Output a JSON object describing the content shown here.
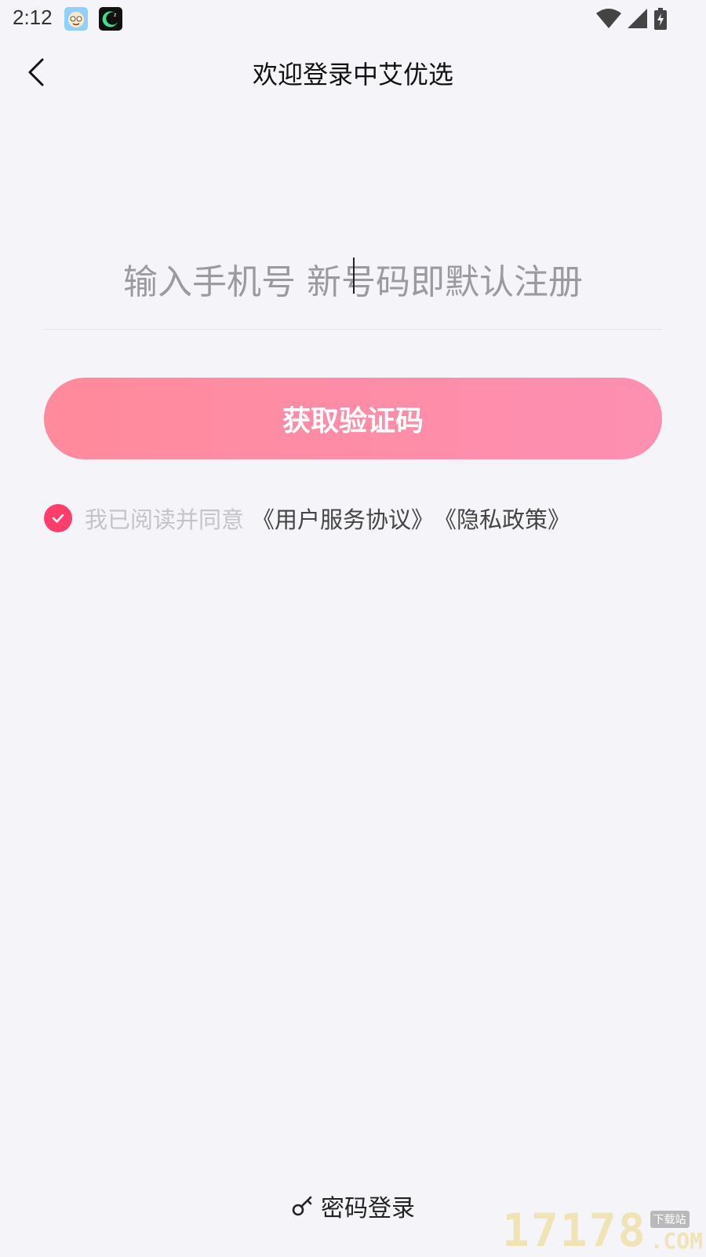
{
  "status_bar": {
    "time": "2:12",
    "icons": [
      "app-cartoon-icon",
      "app-moon-icon",
      "wifi-icon",
      "cell-signal-icon",
      "battery-charging-icon"
    ]
  },
  "header": {
    "title": "欢迎登录中艾优选",
    "back_icon": "chevron-left-icon"
  },
  "login_form": {
    "phone_placeholder": "输入手机号 新号码即默认注册",
    "get_code_label": "获取验证码",
    "agreement": {
      "checked": true,
      "text": "我已阅读并同意",
      "user_agreement_link": "《用户服务协议》",
      "privacy_link": "《隐私政策》"
    }
  },
  "footer": {
    "password_login_label": "密码登录",
    "icon": "key-icon"
  },
  "watermark": {
    "number": "17178",
    "site": "下载站",
    "domain": ".COM"
  },
  "colors": {
    "background": "#f5f5f9",
    "button_gradient_start": "#ff8a9b",
    "button_gradient_end": "#fd8fb2",
    "check_accent": "#fe3f6c"
  }
}
